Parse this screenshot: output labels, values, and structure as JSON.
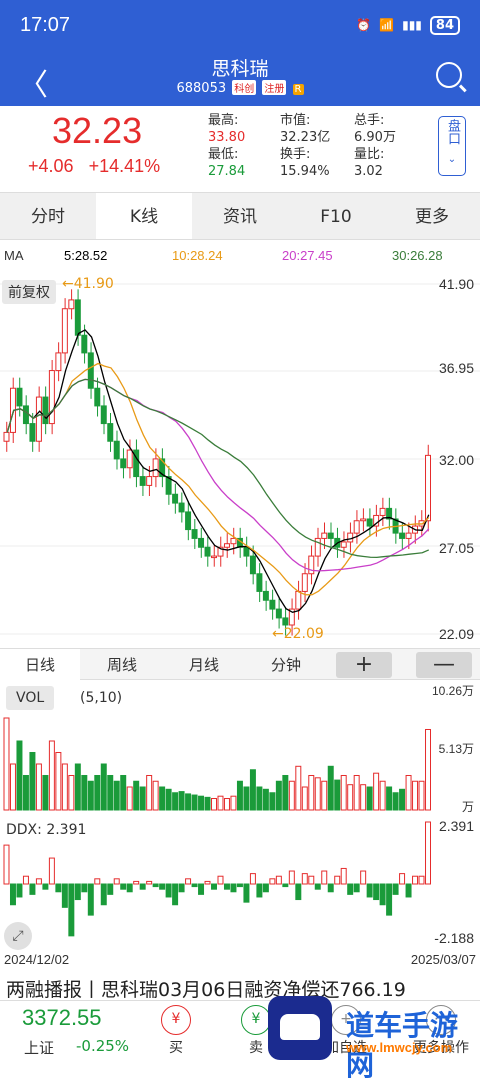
{
  "status": {
    "time": "17:07",
    "battery": "84"
  },
  "nav": {
    "title": "思科瑞",
    "code": "688053",
    "tag1": "科创",
    "tag2": "注册",
    "tag3": "R"
  },
  "quote": {
    "price": "32.23",
    "change": "+4.06",
    "pct": "+14.41%",
    "high_label": "最高:",
    "high": "33.80",
    "low_label": "最低:",
    "low": "27.84",
    "mcap_label": "市值:",
    "mcap": "32.23亿",
    "turnover_label": "换手:",
    "turnover": "15.94%",
    "vol_label": "总手:",
    "vol": "6.90万",
    "ratio_label": "量比:",
    "ratio": "3.02",
    "pankou": "盘口"
  },
  "tabs": [
    "分时",
    "K线",
    "资讯",
    "F10",
    "更多"
  ],
  "ma": {
    "label": "MA",
    "ma5": "5:28.52",
    "ma10": "10:28.24",
    "ma20": "20:27.45",
    "ma30": "30:26.28"
  },
  "colors": {
    "up": "#e52c2c",
    "down": "#1a9b3a",
    "ma5": "#000000",
    "ma10": "#e89a16",
    "ma20": "#c93fc9",
    "ma30": "#3a7d3a",
    "accent": "#2f5fd3"
  },
  "kline": {
    "fuquan": "前复权",
    "yticks": [
      "41.90",
      "36.95",
      "32.00",
      "27.05",
      "22.09"
    ],
    "high_marker": "41.90",
    "low_marker": "22.09"
  },
  "periods": [
    "日线",
    "周线",
    "月线",
    "分钟"
  ],
  "zoom": {
    "plus": "+",
    "minus": "—"
  },
  "volume": {
    "label": "VOL",
    "params": "(5,10)",
    "max": "10.26万",
    "mid": "5.13万",
    "unit": "万"
  },
  "ddx": {
    "label": "DDX: 2.391",
    "max": "2.391",
    "min": "-2.188"
  },
  "dates": {
    "start": "2024/12/02",
    "end": "2025/03/07"
  },
  "news": "两融播报丨思科瑞03月06日融资净偿还766.19",
  "bottom": {
    "index_value": "3372.55",
    "index_name": "上证",
    "index_change": "-0.25%",
    "buy": "买",
    "sell": "卖",
    "add": "加自选",
    "more": "更多操作"
  },
  "watermark": {
    "text": "道车手游网",
    "url": "www.lmwcjy.com"
  }
}
